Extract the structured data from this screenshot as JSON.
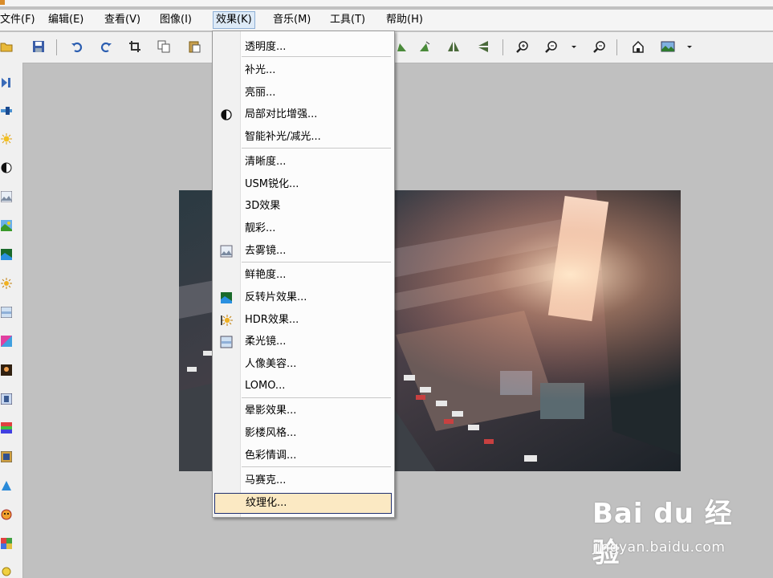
{
  "menubar": {
    "items": [
      {
        "label": "文件(F)"
      },
      {
        "label": "编辑(E)"
      },
      {
        "label": "查看(V)"
      },
      {
        "label": "图像(I)"
      },
      {
        "label": "效果(K)"
      },
      {
        "label": "音乐(M)"
      },
      {
        "label": "工具(T)"
      },
      {
        "label": "帮助(H)"
      }
    ],
    "active_index": 4
  },
  "effects_menu": {
    "items": [
      {
        "label": "透明度..."
      },
      {
        "label": "补光..."
      },
      {
        "label": "亮丽..."
      },
      {
        "label": "局部对比增强...",
        "icon": "contrast-circle-icon"
      },
      {
        "label": "智能补光/减光..."
      },
      {
        "label": "清晰度..."
      },
      {
        "label": "USM锐化..."
      },
      {
        "label": "3D效果"
      },
      {
        "label": "靓彩..."
      },
      {
        "label": "去雾镜...",
        "icon": "dehaze-picture-icon"
      },
      {
        "label": "鲜艳度..."
      },
      {
        "label": "反转片效果...",
        "icon": "reversal-film-icon"
      },
      {
        "label": "HDR效果...",
        "icon": "hdr-sun-icon"
      },
      {
        "label": "柔光镜...",
        "icon": "soft-light-icon"
      },
      {
        "label": "人像美容..."
      },
      {
        "label": "LOMO..."
      },
      {
        "label": "晕影效果..."
      },
      {
        "label": "影楼风格..."
      },
      {
        "label": "色彩情调..."
      },
      {
        "label": "马赛克..."
      },
      {
        "label": "纹理化..."
      }
    ],
    "highlighted_index": 20
  },
  "toolbar": {
    "icons": [
      "open-folder-icon",
      "save-icon",
      "undo-icon",
      "redo-icon",
      "crop-icon",
      "copy-icon",
      "paste-icon",
      "rotate-left-icon",
      "rotate-right-icon",
      "flip-horizontal-icon",
      "flip-vertical-icon",
      "zoom-in-icon",
      "zoom-out-icon",
      "dropdown-arrow-icon",
      "zoom-fit-icon",
      "home-icon",
      "view-mode-icon",
      "dropdown-arrow-icon"
    ]
  },
  "sidebar": {
    "icons": [
      "play-icon",
      "slider-icon",
      "sun-icon",
      "contrast-icon",
      "picture-icon",
      "landscape-icon",
      "reversal-icon",
      "hdr-icon",
      "soft-light-icon",
      "color-icon",
      "portrait-icon",
      "frame-icon",
      "gradient-icon",
      "film-icon",
      "triangle-icon",
      "face-icon",
      "grid-icon",
      "circle-icon"
    ]
  },
  "watermark": {
    "logo": "Bai du 经验",
    "url": "jingyan.baidu.com"
  },
  "colors": {
    "menu_highlight": "#fbe9c3",
    "menu_highlight_border": "#203070",
    "canvas_bg": "#c0c0c0"
  }
}
